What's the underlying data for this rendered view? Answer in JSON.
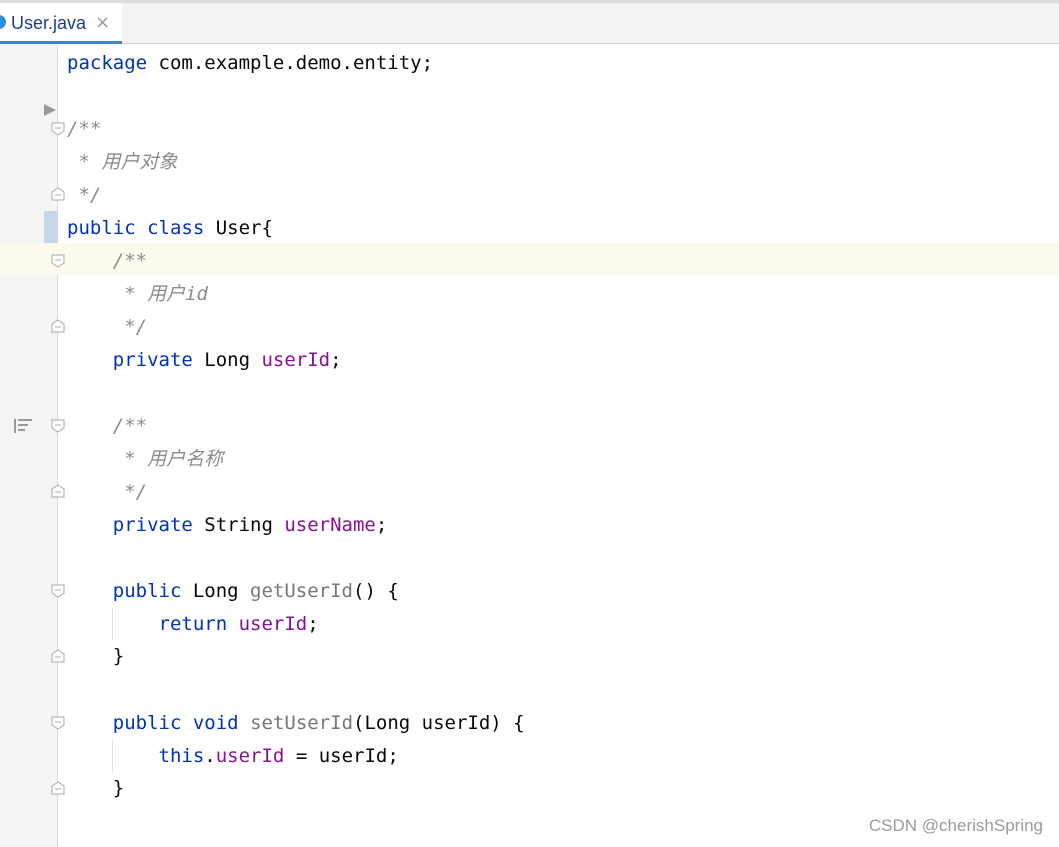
{
  "tab": {
    "label": "User.java",
    "close_glyph": "×"
  },
  "code": {
    "l1": {
      "kw": "package",
      "rest": " com.example.demo.entity;"
    },
    "l3": "/**",
    "l4": " * 用户对象",
    "l5": " */",
    "l6": {
      "kw1": "public",
      "kw2": "class",
      "rest": " User{"
    },
    "l7": "    /**",
    "l8": "     * 用户id",
    "l9": "     */",
    "l10": {
      "indent": "    ",
      "kw": "private",
      "type": " Long ",
      "field": "userId",
      "end": ";"
    },
    "l12": "    /**",
    "l13": "     * 用户名称",
    "l14": "     */",
    "l15": {
      "indent": "    ",
      "kw": "private",
      "type": " String ",
      "field": "userName",
      "end": ";"
    },
    "l17": {
      "indent": "    ",
      "kw": "public",
      "type": " Long ",
      "method": "getUserId",
      "end": "() {"
    },
    "l18": {
      "indent": "        ",
      "kw": "return",
      "sp": " ",
      "field": "userId",
      "end": ";"
    },
    "l19": "    }",
    "l21": {
      "indent": "    ",
      "kw1": "public",
      "kw2": "void",
      "method": "setUserId",
      "end": "(Long userId) {"
    },
    "l22": {
      "indent": "        ",
      "kw": "this",
      "dot": ".",
      "field": "userId",
      "end": " = userId;"
    },
    "l23": "    }"
  },
  "watermark": "CSDN @cherishSpring",
  "colors": {
    "keyword": "#0033b3",
    "field": "#871094",
    "comment": "#8c8c8c",
    "tab_underline": "#4083c9"
  }
}
